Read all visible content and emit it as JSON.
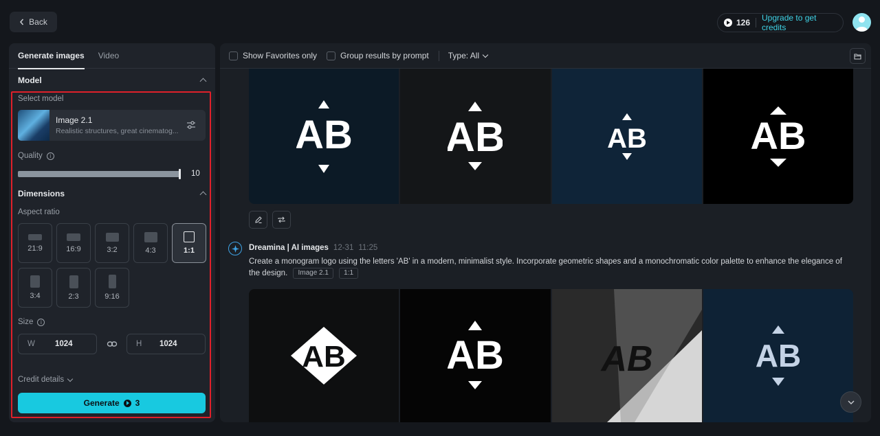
{
  "header": {
    "back_label": "Back",
    "credits_count": "126",
    "upgrade_label": "Upgrade to get credits"
  },
  "left_panel": {
    "tabs": [
      {
        "label": "Generate images",
        "active": true
      },
      {
        "label": "Video",
        "active": false
      }
    ],
    "model_section": "Model",
    "select_model_label": "Select model",
    "model": {
      "name": "Image 2.1",
      "description": "Realistic structures, great cinematog..."
    },
    "quality_label": "Quality",
    "quality_value": "10",
    "quality_fraction": 1.0,
    "dimensions_section": "Dimensions",
    "aspect_ratio_label": "Aspect ratio",
    "aspect_ratios": [
      {
        "label": "21:9"
      },
      {
        "label": "16:9"
      },
      {
        "label": "3:2"
      },
      {
        "label": "4:3"
      },
      {
        "label": "1:1",
        "selected": true
      },
      {
        "label": "3:4"
      },
      {
        "label": "2:3"
      },
      {
        "label": "9:16"
      }
    ],
    "size_label": "Size",
    "width_letter": "W",
    "width_value": "1024",
    "height_letter": "H",
    "height_value": "1024",
    "credit_details_label": "Credit details",
    "generate_label": "Generate",
    "generate_cost": "3"
  },
  "filters": {
    "favorites_label": "Show Favorites only",
    "group_label": "Group results by prompt",
    "type_label": "Type: All"
  },
  "result": {
    "bot_name": "Dreamina | AI images",
    "date": "12-31",
    "time": "11:25",
    "prompt": "Create a monogram logo using the letters 'AB' in a modern, minimalist style. Incorporate geometric shapes and a monochromatic color palette to enhance the elegance of the design.",
    "chips": [
      "Image 2.1",
      "1:1"
    ]
  },
  "top_images": [
    {
      "text": "AB",
      "bg": "#0c1a26"
    },
    {
      "text": "AB",
      "bg": "#141618"
    },
    {
      "text": "AB",
      "bg": "#0f2438"
    },
    {
      "text": "AB",
      "bg": "#000000"
    }
  ],
  "bottom_images": [
    {
      "text": "AB",
      "bg": "#0e0f10"
    },
    {
      "text": "AB",
      "bg": "#050505"
    },
    {
      "text": "AB",
      "bg": "#c9c9c9"
    },
    {
      "text": "AB",
      "bg": "#0e2235"
    }
  ],
  "colors": {
    "accent": "#18c9e0",
    "highlight_border": "#e0202a",
    "upgrade_link": "#3fd3e6"
  }
}
